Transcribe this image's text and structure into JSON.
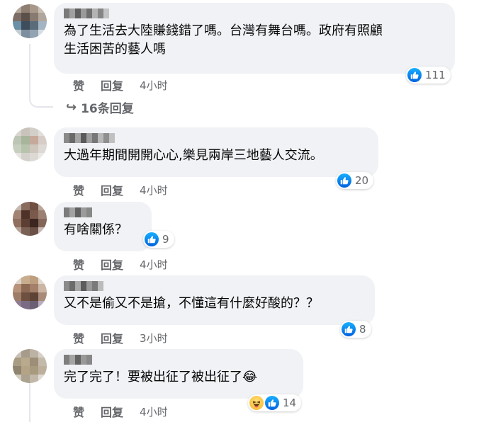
{
  "colors": {
    "bubble_bg": "#f0f2f5",
    "meta_text": "#65676b",
    "like_blue": "#0866ff"
  },
  "comments": [
    {
      "text": "為了生活去大陸賺錢錯了嗎。台灣有舞台嗎。政府有照顧\n生活困苦的藝人嗎",
      "reaction_count": "111",
      "reaction_icons": [
        "like-icon"
      ],
      "like_label": "赞",
      "reply_label": "回复",
      "time": "4小时"
    },
    {
      "text": "大過年期間開開心心,樂見兩岸三地藝人交流。",
      "reaction_count": "20",
      "reaction_icons": [
        "like-icon"
      ],
      "like_label": "赞",
      "reply_label": "回复",
      "time": "4小时"
    },
    {
      "text": "有啥關係？",
      "reaction_count": "9",
      "reaction_icons": [
        "like-icon"
      ],
      "like_label": "赞",
      "reply_label": "回复",
      "time": "4小时"
    },
    {
      "text": "又不是偷又不是搶，不懂這有什麼好酸的？？",
      "reaction_count": "8",
      "reaction_icons": [
        "like-icon"
      ],
      "like_label": "赞",
      "reply_label": "回复",
      "time": "3小时"
    },
    {
      "text": "完了完了！要被出征了被出征了😂",
      "reaction_count": "14",
      "reaction_icons": [
        "haha-icon",
        "like-icon"
      ],
      "like_label": "赞",
      "reply_label": "回复",
      "time": "4小时"
    }
  ],
  "replies_link": {
    "label": "16条回复",
    "icon": "reply-arrow-icon"
  }
}
